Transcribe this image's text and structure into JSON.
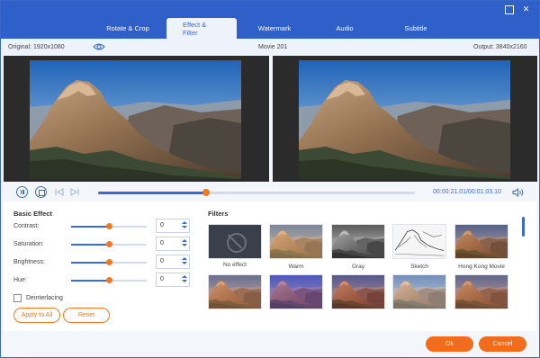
{
  "tabs": [
    {
      "label": "Rotate & Crop",
      "active": false
    },
    {
      "label": "Effect & Filter",
      "active": true
    },
    {
      "label": "Watermark",
      "active": false
    },
    {
      "label": "Audio",
      "active": false
    },
    {
      "label": "Subtitle",
      "active": false
    }
  ],
  "window": {
    "minimize_icon": "minimize-icon",
    "close_symbol": "✕"
  },
  "info": {
    "original": "Original: 1920x1080",
    "title": "Movie 201",
    "output": "Output: 3840x2160"
  },
  "playback": {
    "current_time": "00:00:21.01",
    "total_time": "/00:01:03.10",
    "progress": 0.34
  },
  "basic_effect": {
    "title": "Basic Effect",
    "rows": [
      {
        "label": "Contrast:",
        "value": "0",
        "level": 0.5
      },
      {
        "label": "Saturation:",
        "value": "0",
        "level": 0.5
      },
      {
        "label": "Brightness:",
        "value": "0",
        "level": 0.5
      },
      {
        "label": "Hue:",
        "value": "0",
        "level": 0.5
      }
    ],
    "deinterlacing": "Deinterlacing",
    "apply_all": "Apply to All",
    "reset": "Reset"
  },
  "filters": {
    "title": "Filters",
    "items": [
      {
        "name": "No effect"
      },
      {
        "name": "Warm"
      },
      {
        "name": "Gray"
      },
      {
        "name": "Sketch"
      },
      {
        "name": "Hong Kong Movie"
      },
      {
        "name": ""
      },
      {
        "name": ""
      },
      {
        "name": ""
      },
      {
        "name": ""
      },
      {
        "name": ""
      }
    ]
  },
  "footer": {
    "ok": "Ok",
    "cancel": "Cancel"
  },
  "colors": {
    "accent": "#2f5fc8",
    "orange": "#f26c1d"
  }
}
